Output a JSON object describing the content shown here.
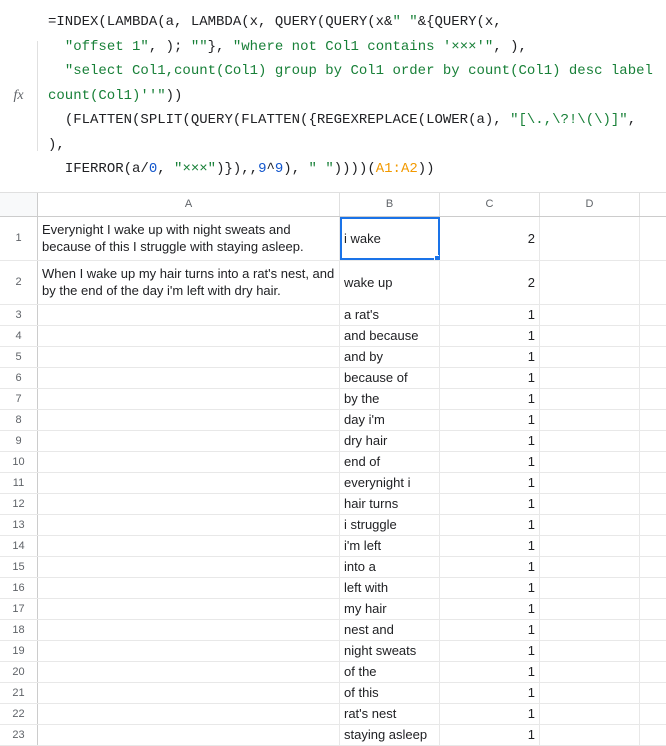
{
  "formula_bar": {
    "fx_label": "fx",
    "parts": [
      {
        "t": "op",
        "v": "=INDEX(LAMBDA(a, LAMBDA(x, QUERY(QUERY(x&"
      },
      {
        "t": "str",
        "v": "\" \""
      },
      {
        "t": "op",
        "v": "&{QUERY(x,"
      },
      {
        "t": "br",
        "v": ""
      },
      {
        "t": "str",
        "v": "\"offset 1\""
      },
      {
        "t": "op",
        "v": ", ); "
      },
      {
        "t": "str",
        "v": "\"\""
      },
      {
        "t": "op",
        "v": "}, "
      },
      {
        "t": "str",
        "v": "\"where not Col1 contains '×××'\""
      },
      {
        "t": "op",
        "v": ", ),"
      },
      {
        "t": "br",
        "v": ""
      },
      {
        "t": "str",
        "v": "\"select Col1,count(Col1) group by Col1 order by count(Col1) desc label count(Col1)''\""
      },
      {
        "t": "op",
        "v": "))"
      },
      {
        "t": "br",
        "v": ""
      },
      {
        "t": "op",
        "v": "(FLATTEN(SPLIT(QUERY(FLATTEN({REGEXREPLACE(LOWER(a), "
      },
      {
        "t": "str",
        "v": "\"[\\.,\\?!\\(\\)]\""
      },
      {
        "t": "op",
        "v": ", ),"
      },
      {
        "t": "br",
        "v": ""
      },
      {
        "t": "op",
        "v": "IFERROR(a/"
      },
      {
        "t": "num",
        "v": "0"
      },
      {
        "t": "op",
        "v": ", "
      },
      {
        "t": "str",
        "v": "\"×××\""
      },
      {
        "t": "op",
        "v": ")}),,"
      },
      {
        "t": "num",
        "v": "9"
      },
      {
        "t": "op",
        "v": "^"
      },
      {
        "t": "num",
        "v": "9"
      },
      {
        "t": "op",
        "v": "), "
      },
      {
        "t": "str",
        "v": "\" \""
      },
      {
        "t": "op",
        "v": "))))("
      },
      {
        "t": "ref",
        "v": "A1:A2"
      },
      {
        "t": "op",
        "v": "))"
      }
    ]
  },
  "columns": [
    "A",
    "B",
    "C",
    "D"
  ],
  "rows": [
    {
      "n": 1,
      "tall": true,
      "A": "Everynight I wake up with night sweats and because of this I struggle with staying asleep.",
      "B": "i wake",
      "C": "2",
      "D": "",
      "selB": true
    },
    {
      "n": 2,
      "tall": true,
      "A": "When I wake up my hair turns into a rat's nest, and by the end of the day i'm left with dry hair.",
      "B": "wake up",
      "C": "2",
      "D": ""
    },
    {
      "n": 3,
      "A": "",
      "B": "a rat's",
      "C": "1",
      "D": ""
    },
    {
      "n": 4,
      "A": "",
      "B": "and because",
      "C": "1",
      "D": ""
    },
    {
      "n": 5,
      "A": "",
      "B": "and by",
      "C": "1",
      "D": ""
    },
    {
      "n": 6,
      "A": "",
      "B": "because of",
      "C": "1",
      "D": ""
    },
    {
      "n": 7,
      "A": "",
      "B": "by the",
      "C": "1",
      "D": ""
    },
    {
      "n": 8,
      "A": "",
      "B": "day i'm",
      "C": "1",
      "D": ""
    },
    {
      "n": 9,
      "A": "",
      "B": "dry hair",
      "C": "1",
      "D": ""
    },
    {
      "n": 10,
      "A": "",
      "B": "end of",
      "C": "1",
      "D": ""
    },
    {
      "n": 11,
      "A": "",
      "B": "everynight i",
      "C": "1",
      "D": ""
    },
    {
      "n": 12,
      "A": "",
      "B": "hair turns",
      "C": "1",
      "D": ""
    },
    {
      "n": 13,
      "A": "",
      "B": "i struggle",
      "C": "1",
      "D": ""
    },
    {
      "n": 14,
      "A": "",
      "B": "i'm left",
      "C": "1",
      "D": ""
    },
    {
      "n": 15,
      "A": "",
      "B": "into a",
      "C": "1",
      "D": ""
    },
    {
      "n": 16,
      "A": "",
      "B": "left with",
      "C": "1",
      "D": ""
    },
    {
      "n": 17,
      "A": "",
      "B": "my hair",
      "C": "1",
      "D": ""
    },
    {
      "n": 18,
      "A": "",
      "B": "nest and",
      "C": "1",
      "D": ""
    },
    {
      "n": 19,
      "A": "",
      "B": "night sweats",
      "C": "1",
      "D": ""
    },
    {
      "n": 20,
      "A": "",
      "B": "of the",
      "C": "1",
      "D": ""
    },
    {
      "n": 21,
      "A": "",
      "B": "of this",
      "C": "1",
      "D": ""
    },
    {
      "n": 22,
      "A": "",
      "B": "rat's nest",
      "C": "1",
      "D": ""
    },
    {
      "n": 23,
      "A": "",
      "B": "staying asleep",
      "C": "1",
      "D": ""
    }
  ]
}
